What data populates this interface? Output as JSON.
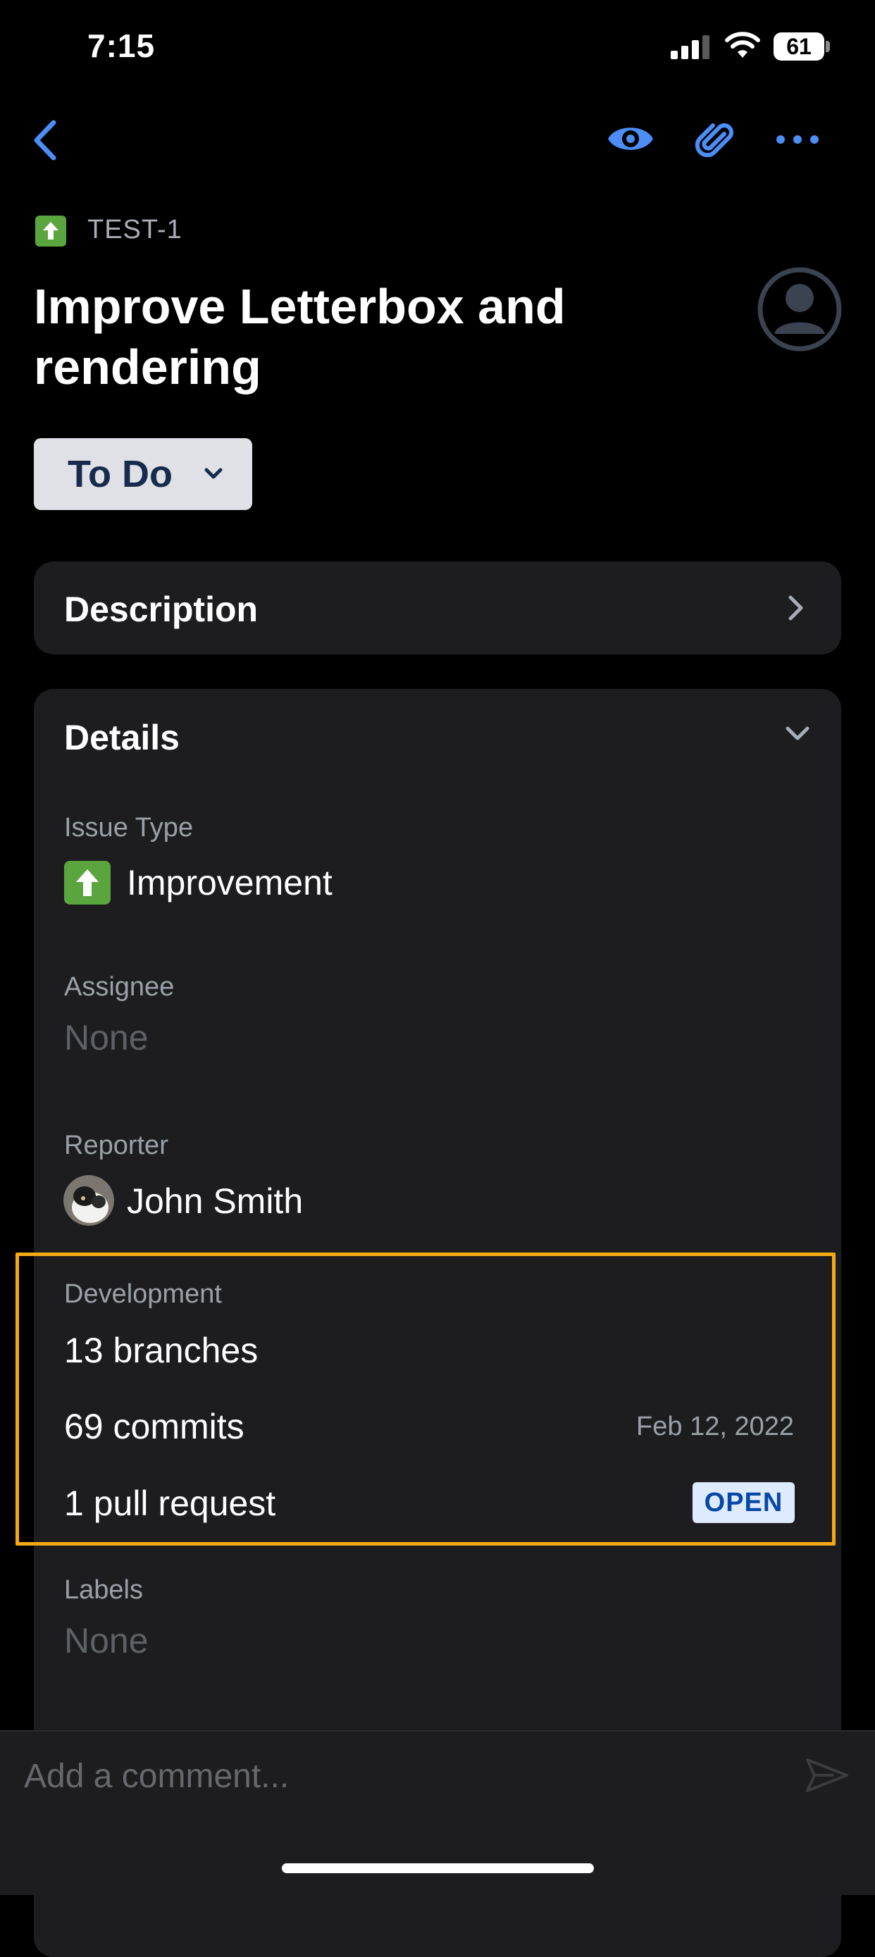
{
  "status_bar": {
    "time": "7:15",
    "battery": "61"
  },
  "nav": {
    "back_icon": "chevron-left-icon",
    "watch_icon": "eye-icon",
    "attach_icon": "paperclip-icon",
    "more_icon": "more-horizontal-icon",
    "accent_color": "#4c8df6"
  },
  "issue": {
    "key": "TEST-1",
    "title": "Improve Letterbox and rendering",
    "status": "To Do"
  },
  "description": {
    "label": "Description"
  },
  "details": {
    "label": "Details",
    "issue_type": {
      "label": "Issue Type",
      "value": "Improvement",
      "icon": "arrow-up-icon",
      "color": "#5ba53f"
    },
    "assignee": {
      "label": "Assignee",
      "value": "None"
    },
    "reporter": {
      "label": "Reporter",
      "value": "John Smith"
    },
    "development": {
      "label": "Development",
      "branches": "13 branches",
      "commits": "69 commits",
      "commits_date": "Feb 12, 2022",
      "pull_requests": "1 pull request",
      "pr_status": "OPEN",
      "highlight_color": "#f5a914"
    },
    "labels": {
      "label": "Labels",
      "value": "None"
    }
  },
  "comment": {
    "placeholder": "Add a comment..."
  }
}
